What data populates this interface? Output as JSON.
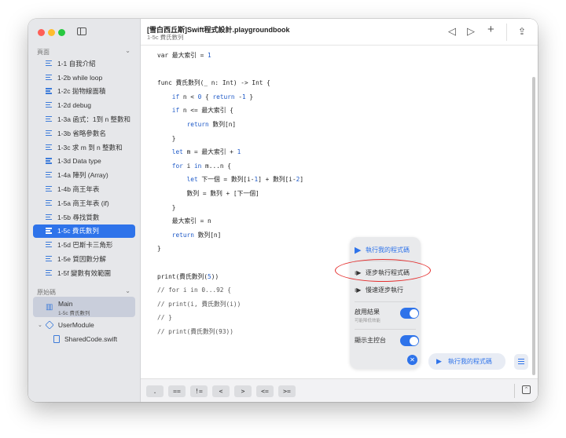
{
  "window": {
    "title": "[雪白西丘斯]Swift程式設計.playgroundbook",
    "subtitle": "1-5c 費氏數列"
  },
  "sidebar": {
    "pages_header": "頁面",
    "pages": [
      {
        "label": "1-1 自我介紹"
      },
      {
        "label": "1-2b while loop"
      },
      {
        "label": "1-2c 拋物線面積"
      },
      {
        "label": "1-2d debug"
      },
      {
        "label": "1-3a 函式：1到 n 整數和"
      },
      {
        "label": "1-3b 省略參數名"
      },
      {
        "label": "1-3c 求 m 到 n 整數和"
      },
      {
        "label": "1-3d Data type"
      },
      {
        "label": "1-4a 陣列 (Array)"
      },
      {
        "label": "1-4b 商王年表"
      },
      {
        "label": "1-5a 商王年表 (if)"
      },
      {
        "label": "1-5b 尋找質數"
      },
      {
        "label": "1-5c 費氏數列",
        "selected": true
      },
      {
        "label": "1-5d 巴斯卡三角形"
      },
      {
        "label": "1-5e 質因數分解"
      },
      {
        "label": "1-5f 變數有效範圍"
      }
    ],
    "source_header": "原始碼",
    "main": {
      "label": "Main",
      "sublabel": "1-5c 費氏數列"
    },
    "module": {
      "label": "UserModule"
    },
    "shared": {
      "label": "SharedCode.swift"
    }
  },
  "code_lines": [
    [
      [
        "p",
        "var 最大索引 = "
      ],
      [
        "n",
        "1"
      ]
    ],
    [],
    [
      [
        "p",
        "func 費氏數列(_ n: Int) -> Int {"
      ]
    ],
    [
      [
        "p",
        "    "
      ],
      [
        "k",
        "if"
      ],
      [
        "p",
        " n < "
      ],
      [
        "n",
        "0"
      ],
      [
        "p",
        " { "
      ],
      [
        "k",
        "return"
      ],
      [
        "p",
        " -"
      ],
      [
        "n",
        "1"
      ],
      [
        "p",
        " }"
      ]
    ],
    [
      [
        "p",
        "    "
      ],
      [
        "k",
        "if"
      ],
      [
        "p",
        " n <= 最大索引 {"
      ]
    ],
    [
      [
        "p",
        "        "
      ],
      [
        "k",
        "return"
      ],
      [
        "p",
        " 數列[n]"
      ]
    ],
    [
      [
        "p",
        "    }"
      ]
    ],
    [
      [
        "p",
        "    "
      ],
      [
        "k",
        "let"
      ],
      [
        "p",
        " m = 最大索引 + "
      ],
      [
        "n",
        "1"
      ]
    ],
    [
      [
        "p",
        "    "
      ],
      [
        "k",
        "for"
      ],
      [
        "p",
        " i "
      ],
      [
        "k",
        "in"
      ],
      [
        "p",
        " m...n {"
      ]
    ],
    [
      [
        "p",
        "        "
      ],
      [
        "k",
        "let"
      ],
      [
        "p",
        " 下一個 = 數列[i-"
      ],
      [
        "n",
        "1"
      ],
      [
        "p",
        "] + 數列[i-"
      ],
      [
        "n",
        "2"
      ],
      [
        "p",
        "]"
      ]
    ],
    [
      [
        "p",
        "        數列 = 數列 + [下一個]"
      ]
    ],
    [
      [
        "p",
        "    }"
      ]
    ],
    [
      [
        "p",
        "    最大索引 = n"
      ]
    ],
    [
      [
        "p",
        "    "
      ],
      [
        "k",
        "return"
      ],
      [
        "p",
        " 數列[n]"
      ]
    ],
    [
      [
        "p",
        "}"
      ]
    ],
    [],
    [
      [
        "p",
        "print(費氏數列("
      ],
      [
        "n",
        "5"
      ],
      [
        "p",
        "))"
      ]
    ],
    [
      [
        "c",
        "// for i in 0...92 {"
      ]
    ],
    [
      [
        "c",
        "// print(i, 費氏數列(i))"
      ]
    ],
    [
      [
        "c",
        "// }"
      ]
    ],
    [
      [
        "c",
        "// print(費氏數列(93))"
      ]
    ]
  ],
  "popover": {
    "run_label": "執行我的程式碼",
    "step_label": "逐步執行程式碼",
    "slow_step_label": "慢速逐步執行",
    "results_label": "啟用結果",
    "results_sub": "可能降低效能",
    "console_label": "顯示主控台"
  },
  "run_button_label": "執行我的程式碼",
  "keyboard_keys": [
    ".",
    "==",
    "!=",
    "<",
    ">",
    "<=",
    ">="
  ],
  "colors": {
    "accent": "#2e73ea",
    "keyword": "#1c58c7",
    "highlight_ring": "#e5302f"
  }
}
